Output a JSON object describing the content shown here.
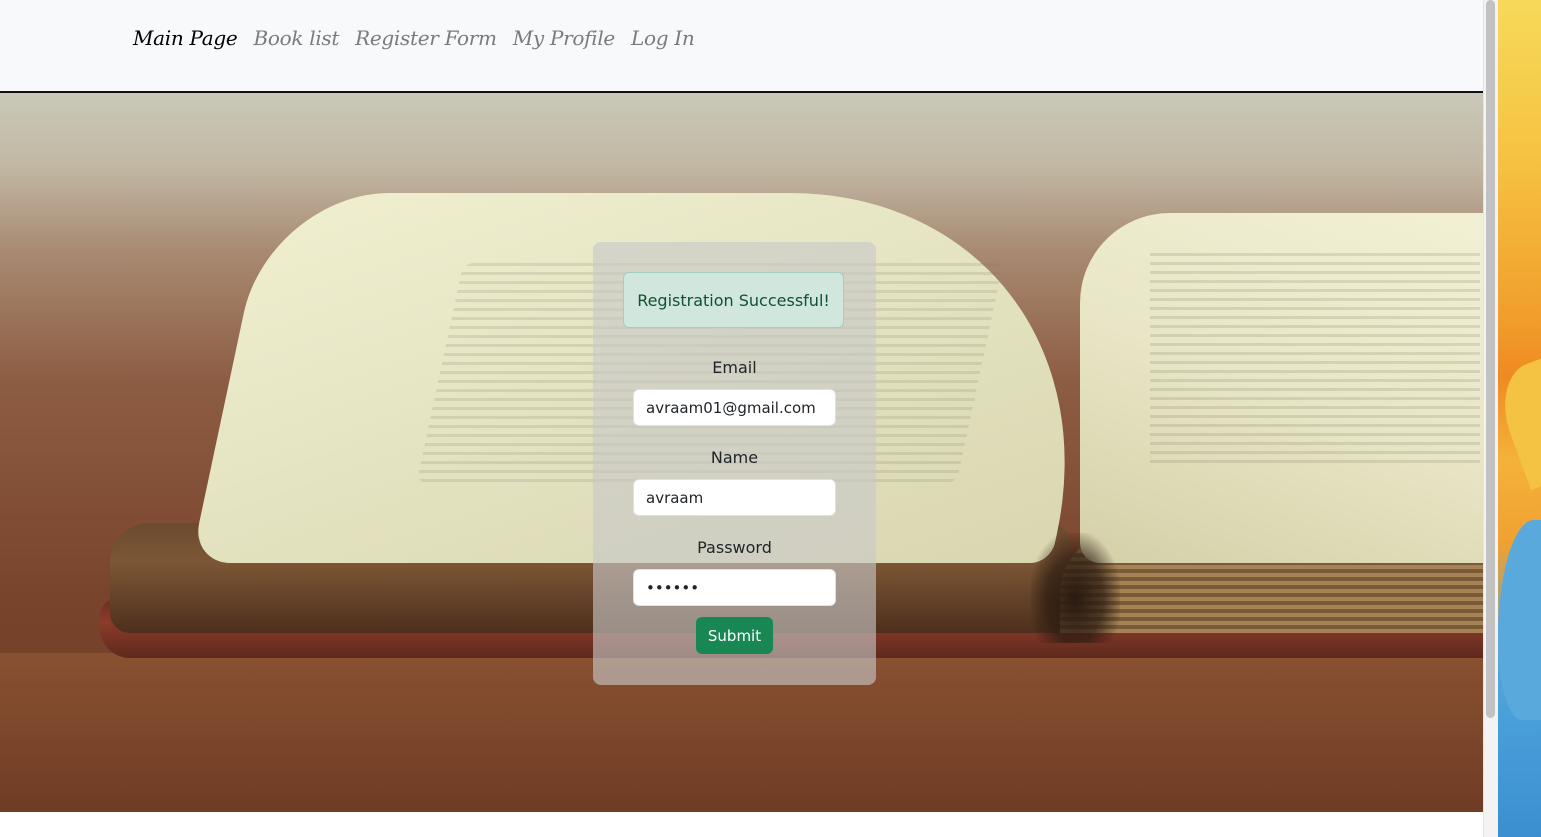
{
  "nav": {
    "items": [
      {
        "label": "Main Page",
        "active": true
      },
      {
        "label": "Book list",
        "active": false
      },
      {
        "label": "Register Form",
        "active": false
      },
      {
        "label": "My Profile",
        "active": false
      },
      {
        "label": "Log In",
        "active": false
      }
    ]
  },
  "form": {
    "alert": "Registration Successful!",
    "email_label": "Email",
    "email_value": "avraam01@gmail.com",
    "name_label": "Name",
    "name_value": "avraam",
    "password_label": "Password",
    "password_value": "••••••",
    "submit_label": "Submit"
  },
  "colors": {
    "navbar_bg": "#f8f9fa",
    "alert_bg": "#d1e7dd",
    "submit_bg": "#198754"
  }
}
